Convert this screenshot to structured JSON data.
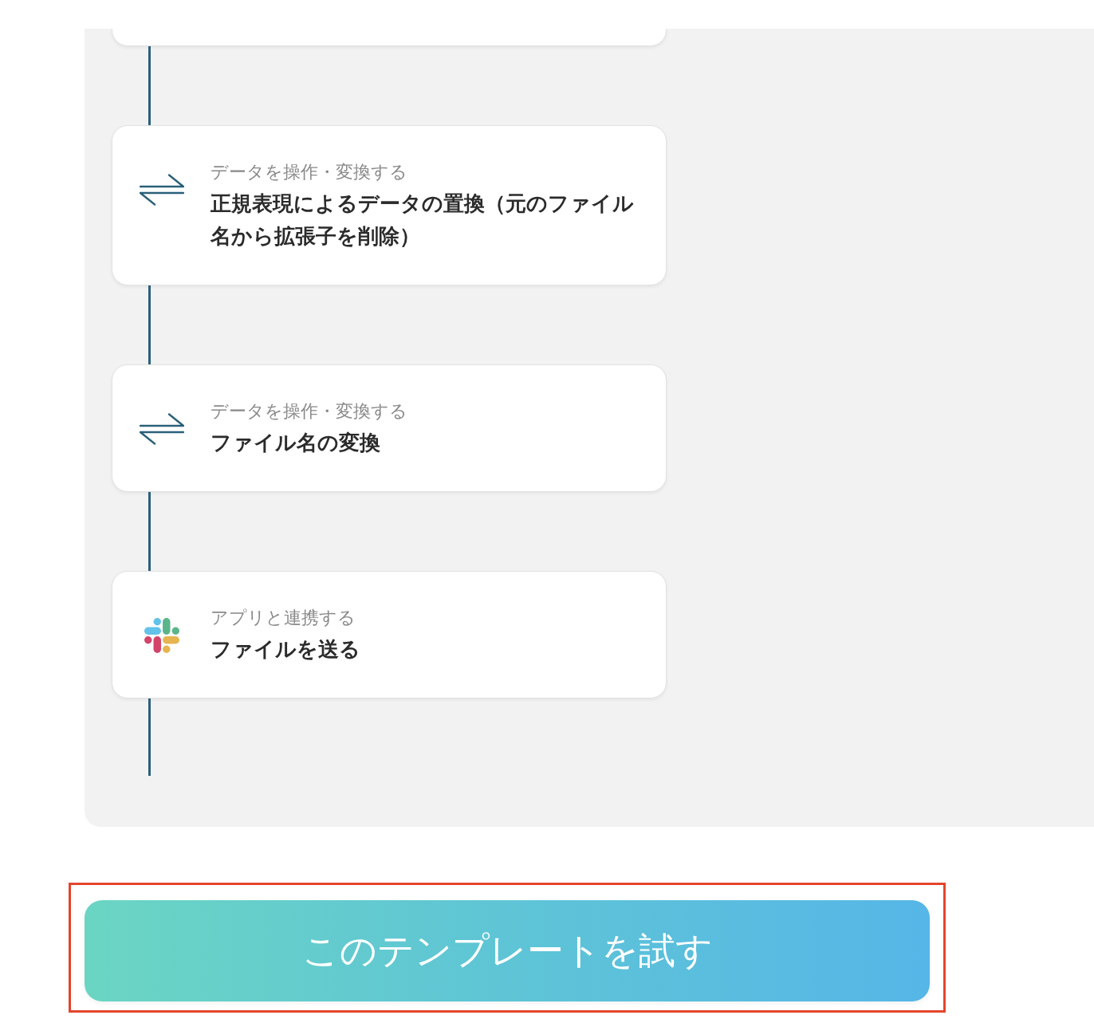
{
  "steps": [
    {
      "kind": "transform",
      "category": "データを操作・変換する",
      "title": "正規表現によるデータの置換（元のファイル名から拡張子を削除）"
    },
    {
      "kind": "transform",
      "category": "データを操作・変換する",
      "title": "ファイル名の変換"
    },
    {
      "kind": "app",
      "category": "アプリと連携する",
      "title": "ファイルを送る"
    }
  ],
  "try_button": {
    "label": "このテンプレートを試す",
    "highlighted": true
  }
}
